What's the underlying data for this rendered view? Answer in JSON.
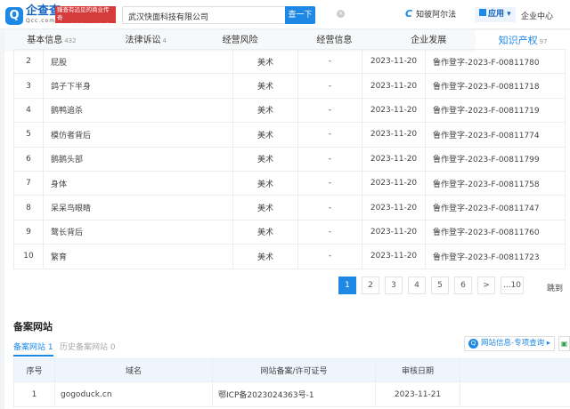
{
  "header": {
    "logo_cn": "企查查",
    "logo_en": "Qcc.com",
    "slogan_line1": "臻查有远见的商业传奇",
    "slogan_line2": "全国企业信用查询系统",
    "search_value": "武汉快面科技有限公司",
    "search_button": "查一下",
    "zhibo": "知彼阿尔法",
    "app": "应用",
    "center": "企业中心"
  },
  "tabs": [
    {
      "label": "基本信息",
      "count": "432"
    },
    {
      "label": "法律诉讼",
      "count": "4"
    },
    {
      "label": "经营风险",
      "count": ""
    },
    {
      "label": "经营信息",
      "count": ""
    },
    {
      "label": "企业发展",
      "count": ""
    },
    {
      "label": "知识产权",
      "count": "97"
    }
  ],
  "ip_rows": [
    {
      "no": "2",
      "name": "屁股",
      "type": "美术",
      "extra": "-",
      "date": "2023-11-20",
      "reg": "鲁作登字-2023-F-00811780"
    },
    {
      "no": "3",
      "name": "鸽子下半身",
      "type": "美术",
      "extra": "-",
      "date": "2023-11-20",
      "reg": "鲁作登字-2023-F-00811718"
    },
    {
      "no": "4",
      "name": "鹅鸭追杀",
      "type": "美术",
      "extra": "-",
      "date": "2023-11-20",
      "reg": "鲁作登字-2023-F-00811719"
    },
    {
      "no": "5",
      "name": "模仿者背后",
      "type": "美术",
      "extra": "-",
      "date": "2023-11-20",
      "reg": "鲁作登字-2023-F-00811774"
    },
    {
      "no": "6",
      "name": "鹅鹅头部",
      "type": "美术",
      "extra": "-",
      "date": "2023-11-20",
      "reg": "鲁作登字-2023-F-00811799"
    },
    {
      "no": "7",
      "name": "身体",
      "type": "美术",
      "extra": "-",
      "date": "2023-11-20",
      "reg": "鲁作登字-2023-F-00811758"
    },
    {
      "no": "8",
      "name": "呆呆鸟眼睛",
      "type": "美术",
      "extra": "-",
      "date": "2023-11-20",
      "reg": "鲁作登字-2023-F-00811747"
    },
    {
      "no": "9",
      "name": "鹜长背后",
      "type": "美术",
      "extra": "-",
      "date": "2023-11-20",
      "reg": "鲁作登字-2023-F-00811760"
    },
    {
      "no": "10",
      "name": "繁育",
      "type": "美术",
      "extra": "-",
      "date": "2023-11-20",
      "reg": "鲁作登字-2023-F-00811723"
    }
  ],
  "pagination": {
    "pages": [
      "1",
      "2",
      "3",
      "4",
      "5",
      "6"
    ],
    "next": ">",
    "last": "...10",
    "jump": "跳到"
  },
  "website": {
    "title": "备案网站",
    "tab_active": "备案网站 1",
    "tab_history": "历史备案网站 0",
    "info_button": "网站信息-专项查询 ▸",
    "columns": [
      "序号",
      "域名",
      "网站备案/许可证号",
      "审核日期"
    ],
    "rows": [
      {
        "no": "1",
        "domain": "gogoduck.cn",
        "license": "鄂ICP备2023024363号-1",
        "date": "2023-11-21"
      }
    ]
  }
}
